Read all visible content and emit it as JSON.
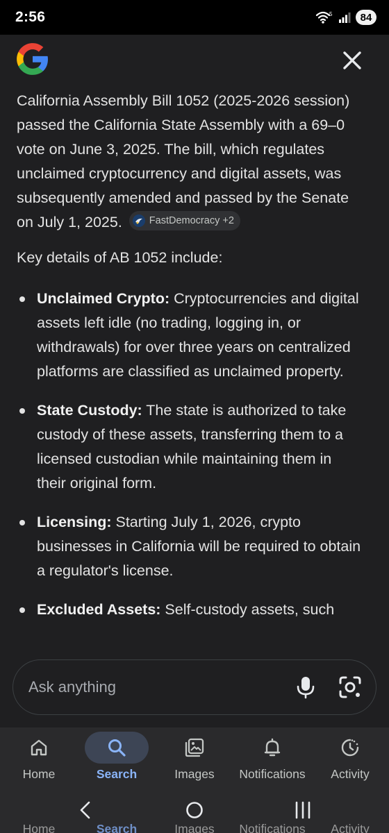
{
  "status_bar": {
    "time": "2:56",
    "wifi_label": "5",
    "battery": "84"
  },
  "top_bar": {
    "logo": "google-g-logo",
    "close_icon": "close-icon"
  },
  "answer": {
    "intro": "California Assembly Bill 1052 (2025-2026 session) passed the California State Assembly with a 69–0 vote on June 3, 2025. The bill, which regulates unclaimed cryptocurrency and digital assets, was subsequently amended and passed by the Senate on July 1, 2025.",
    "source_chip": "FastDemocracy +2",
    "key_intro": "Key details of AB 1052 include:",
    "details": [
      {
        "term": "Unclaimed Crypto:",
        "text": " Cryptocurrencies and digital assets left idle (no trading, logging in, or withdrawals) for over three years on centralized platforms are classified as unclaimed property."
      },
      {
        "term": "State Custody:",
        "text": " The state is authorized to take custody of these assets, transferring them to a licensed custodian while maintaining them in their original form."
      },
      {
        "term": "Licensing:",
        "text": " Starting July 1, 2026, crypto businesses in California will be required to obtain a regulator's license."
      },
      {
        "term": "Excluded Assets:",
        "text": " Self-custody assets, such"
      }
    ]
  },
  "ask_bar": {
    "placeholder": "Ask anything",
    "mic_icon": "mic-icon",
    "lens_icon": "lens-icon"
  },
  "bottom_nav": {
    "items": [
      {
        "label": "Home",
        "icon": "home-icon"
      },
      {
        "label": "Search",
        "icon": "search-icon",
        "active": true
      },
      {
        "label": "Images",
        "icon": "images-icon"
      },
      {
        "label": "Notifications",
        "icon": "bell-icon"
      },
      {
        "label": "Activity",
        "icon": "activity-icon"
      }
    ]
  },
  "system_nav": {
    "back": "back-icon",
    "home": "home-circle-icon",
    "recents": "recents-icon"
  },
  "colors": {
    "background": "#1f1f21",
    "accent": "#8ab4f8",
    "nav_active_bg": "#3d4555"
  }
}
